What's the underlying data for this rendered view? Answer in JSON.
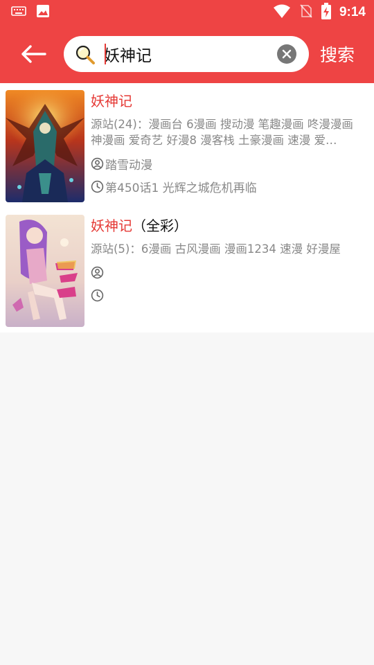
{
  "status": {
    "time": "9:14",
    "icons": [
      "keyboard-icon",
      "image-icon",
      "wifi-icon",
      "no-sim-icon",
      "battery-charging-icon"
    ]
  },
  "search": {
    "query": "妖神记",
    "button_label": "搜索"
  },
  "results": [
    {
      "title": "妖神记",
      "title_suffix": "",
      "sources": "源站(24)：漫画台 6漫画 搜动漫 笔趣漫画 咚漫漫画 神漫画 爱奇艺 好漫8 漫客栈 土豪漫画 速漫 爱…",
      "author": "踏雪动漫",
      "latest": "第450话1 光辉之城危机再临"
    },
    {
      "title": "妖神记",
      "title_suffix": "（全彩）",
      "sources": "源站(5)：6漫画 古风漫画 漫画1234 速漫 好漫屋",
      "author": "",
      "latest": ""
    }
  ],
  "colors": {
    "primary": "#ee4444",
    "title": "#e53935"
  }
}
